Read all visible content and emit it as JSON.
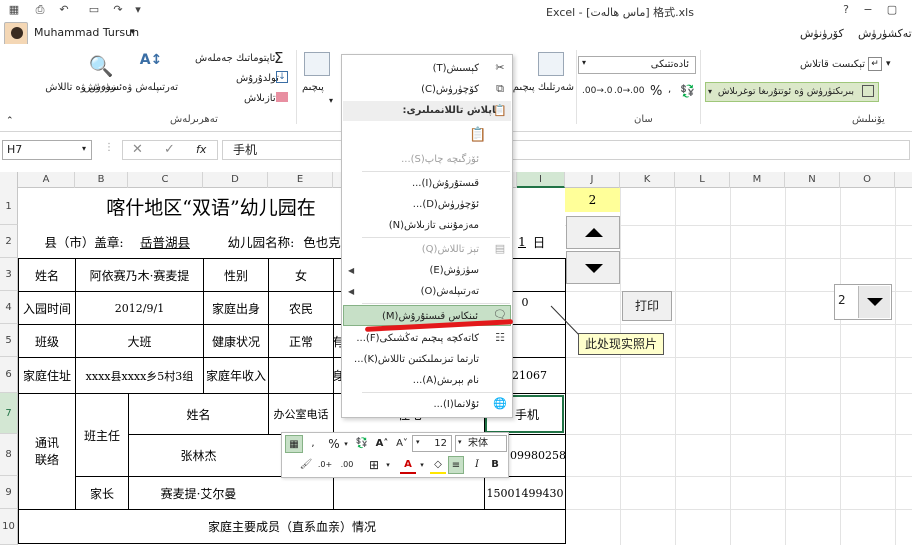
{
  "window": {
    "title": "格式.xls  [ماس ھالەت]  - Excel",
    "user": "Muhammad Tursun"
  },
  "tabs": {
    "view": "كۆرۈنۈش",
    "review": "تەكشۈرۈش"
  },
  "ribbon": {
    "autosum": "ئاپتوماتىك جەملەش",
    "fill": "تولدۇرۇش",
    "clear": "تازىلاش",
    "sort_filter": "تەرتىپلەش ۋە سۈزۈش",
    "find_select": "ئىزدەش ۋە تاللاش",
    "editing_group": "تەھرىرلەش",
    "insert": "قىستۇرۇش",
    "delete": "ئۆچۈرۈش",
    "format": "پىچىم",
    "cells_group": "كاتەكچە",
    "number_format": "ئادەتتىكى",
    "number_group": "سان",
    "wrap_text": "تېكىست قاتلاش",
    "merge_center": "بىرىكتۈرۈش ۋە ئوتتۇرىغا توغرىلاش",
    "alignment_group": "يۆنىلىش",
    "paste_group": "ئىگە",
    "conditional_format": "شەرتلىك پىچىم",
    "table_format": "جەدۋەل پىچىمى",
    "cell_styles": "كاتەكچە ئۇسلۇبى"
  },
  "formula_bar": {
    "name_box": "H7",
    "content": "手机",
    "fx": "fx"
  },
  "columns": [
    "A",
    "B",
    "C",
    "D",
    "E",
    "F",
    "G",
    "H",
    "I",
    "J",
    "K",
    "L",
    "M",
    "N",
    "O"
  ],
  "rows": [
    "1",
    "2",
    "3",
    "4",
    "5",
    "6",
    "7",
    "8",
    "9",
    "10"
  ],
  "sheet": {
    "title": "喀什地区“双语”幼儿园在",
    "county_label": "县（市）盖章:",
    "county_value": "岳普湖县",
    "kg_label": "幼儿园名称:",
    "kg_value": "色也克",
    "day_value": "1",
    "day_label": "日",
    "name_label": "姓名",
    "name_value": "阿依赛乃木·赛麦提",
    "gender_label": "性别",
    "gender_value": "女",
    "entry_label": "入园时间",
    "entry_value": "2012/9/1",
    "origin_label": "家庭出身",
    "origin_value": "农民",
    "zero_value": "0",
    "class_label": "班级",
    "class_value": "大班",
    "health_label": "健康状况",
    "health_value": "正常",
    "health_extra": "有",
    "address_label": "家庭住址",
    "address_value": "xxxx县xxxx乡5村3组",
    "income_label": "家庭年收入",
    "income_extra": "身",
    "id_partial": "21067",
    "contact_label": "通讯联络",
    "teacher_label": "班主任",
    "name_header": "姓名",
    "office_phone": "办公室电话",
    "home_phone": "住宅",
    "mobile": "手机",
    "teacher_name": "张林杰",
    "teacher_mobile": "09980258",
    "parent_label": "家长",
    "parent_name": "赛麦提·艾尔曼",
    "parent_mobile": "15001499430",
    "family_members": "家庭主要成员（直系血亲）情况",
    "j1_value": "2"
  },
  "controls": {
    "print_button": "打印",
    "callout": "此处现实照片",
    "combo_value": "2"
  },
  "context_menu": {
    "cut": "كېسىش(T)",
    "copy": "كۆچۈرۈش(C)",
    "paste_options": "چاپلاش تاللانمىلىرى:",
    "paste_special": "ئۆزگىچە چاپ(S)...",
    "insert": "قىستۇرۇش(I)...",
    "delete": "ئۆچۈرۈش(D)...",
    "clear_contents": "مەزمۇننى تازىلاش(N)",
    "quick_analysis": "تېز تاللاش(Q)",
    "filter": "سۈزۈش(E)",
    "sort": "تەرتىپلەش(O)",
    "insert_comment": "ئىنكاس قىستۇرۇش(M)",
    "format_cells": "كاتەكچە پىچىم تەڭشىكى(F)...",
    "pick_from_list": "تارتما تىزىملىكتىن تاللاش(K)...",
    "define_name": "نام بېرىش(A)...",
    "hyperlink": "ئۇلانما(I)..."
  },
  "mini_toolbar": {
    "font_name": "宋体",
    "font_size": "12",
    "bold": "B",
    "italic": "I",
    "percent": "%",
    "comma": ","
  },
  "colors": {
    "highlight_yellow": "#ffff99",
    "menu_hover_green": "#c7e0c7",
    "red_mark": "#e3191b",
    "green_selection": "#217346"
  }
}
